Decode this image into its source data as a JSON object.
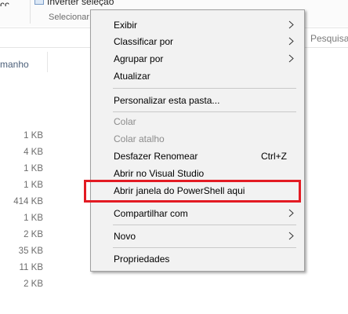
{
  "ribbon": {
    "cut_text": "ccto",
    "invert_label": "Inverter seleção",
    "group_label": "Selecionar"
  },
  "search": {
    "placeholder": "Pesquisar"
  },
  "column_header": "manho",
  "file_sizes": [
    "1 KB",
    "4 KB",
    "1 KB",
    "1 KB",
    "414 KB",
    "1 KB",
    "2 KB",
    "35 KB",
    "11 KB",
    "2 KB"
  ],
  "menu": {
    "view": "Exibir",
    "sort_by": "Classificar por",
    "group_by": "Agrupar por",
    "refresh": "Atualizar",
    "customize": "Personalizar esta pasta...",
    "paste": "Colar",
    "paste_shortcut": "Colar atalho",
    "undo_rename": "Desfazer Renomear",
    "undo_shortcut": "Ctrl+Z",
    "open_visual_studio": "Abrir no Visual Studio",
    "open_powershell": "Abrir janela do PowerShell aqui",
    "share_with": "Compartilhar com",
    "new": "Novo",
    "properties": "Propriedades"
  },
  "colors": {
    "highlight_box": "#e31b23",
    "menu_bg": "#f2f2f2"
  }
}
